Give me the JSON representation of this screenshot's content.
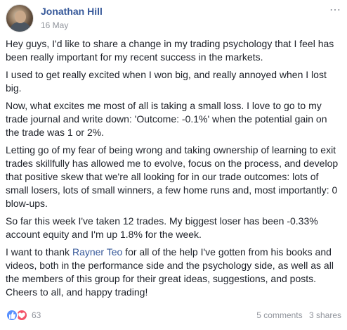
{
  "post": {
    "author": "Jonathan Hill",
    "date": "16 May",
    "more_icon": "ellipsis-icon",
    "paragraphs": [
      "Hey guys, I'd like to share a change in my trading psychology that I feel has been really important for my recent success in the markets.",
      "I used to get really excited when I won big, and really annoyed when I lost big.",
      "Now, what excites me most of all is taking a small loss. I love to go to my trade journal and write down: 'Outcome: -0.1%' when the potential gain on the trade was 1 or 2%.",
      "Letting go of my fear of being wrong and taking ownership of learning to exit trades skillfully has allowed me to evolve, focus on the process, and develop that positive skew that we're all looking for in our trade outcomes: lots of small losers, lots of small winners, a few home runs and, most importantly: 0 blow-ups.",
      "So far this week I've taken 12 trades. My biggest loser has been -0.33% account equity and I'm up 1.8% for the week."
    ],
    "last_paragraph": {
      "before_link": "I want to thank ",
      "link": "Rayner Teo",
      "after_link": " for all of the help I've gotten from his books and videos, both in the performance side and the psychology side, as well as all the members of this group for their great ideas, suggestions, and posts. Cheers to all, and happy trading!"
    },
    "reactions": {
      "icons": [
        "like-icon",
        "love-icon"
      ],
      "count": "63"
    },
    "comments": "5 comments",
    "shares": "3 shares"
  },
  "colors": {
    "link": "#365899",
    "text": "#1d2129",
    "muted": "#90949c",
    "like": "#5890ff",
    "love": "#f25268"
  }
}
